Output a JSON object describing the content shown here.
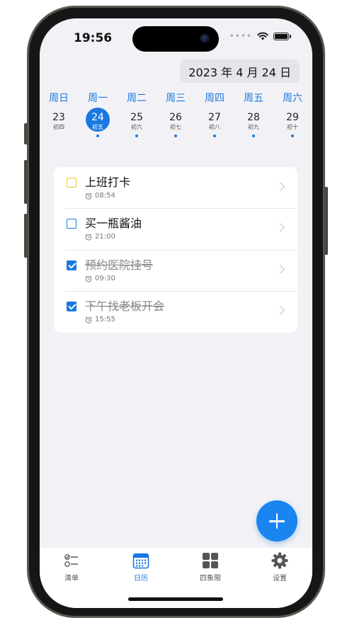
{
  "status": {
    "time": "19:56",
    "dots": "••••"
  },
  "header": {
    "date": "2023 年 4 月 24 日"
  },
  "week": {
    "headers": [
      "周日",
      "周一",
      "周二",
      "周三",
      "周四",
      "周五",
      "周六"
    ],
    "days": [
      {
        "num": "23",
        "lunar": "初四"
      },
      {
        "num": "24",
        "lunar": "初五"
      },
      {
        "num": "25",
        "lunar": "初六"
      },
      {
        "num": "26",
        "lunar": "初七"
      },
      {
        "num": "27",
        "lunar": "初八"
      },
      {
        "num": "28",
        "lunar": "初九"
      },
      {
        "num": "29",
        "lunar": "初十"
      }
    ]
  },
  "tasks": [
    {
      "title": "上班打卡",
      "time": "08:54",
      "done": false
    },
    {
      "title": "买一瓶酱油",
      "time": "21:00",
      "done": false
    },
    {
      "title": "预约医院挂号",
      "time": "09:30",
      "done": true
    },
    {
      "title": "下午找老板开会",
      "time": "15:55",
      "done": true
    }
  ],
  "tabs": [
    {
      "label": "清单"
    },
    {
      "label": "日历"
    },
    {
      "label": "四象限"
    },
    {
      "label": "设置"
    }
  ],
  "colors": {
    "accent": "#1a78e0",
    "background": "#f2f2f6",
    "first_checkbox": "#f4c430"
  }
}
